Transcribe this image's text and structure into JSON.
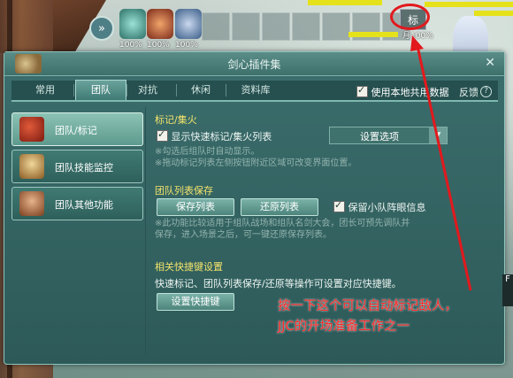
{
  "hud": {
    "buff_pcts": [
      "100%",
      "100%",
      "100%"
    ],
    "mark_label": "标",
    "mark_pct": "100%",
    "mark_prefix": "月"
  },
  "panel": {
    "title": "剑心插件集",
    "close": "✕",
    "tabs": [
      "常用",
      "团队",
      "对抗",
      "休闲",
      "资料库"
    ],
    "active_tab": "团队",
    "use_local_data_label": "使用本地共用数据",
    "feedback_label": "反馈",
    "help": "?"
  },
  "sidebar": {
    "items": [
      {
        "label": "团队/标记",
        "icon": "red-flag-icon",
        "active": true
      },
      {
        "label": "团队技能监控",
        "icon": "bell-tower-icon",
        "active": false
      },
      {
        "label": "团队其他功能",
        "icon": "gate-icon",
        "active": false
      }
    ]
  },
  "content": {
    "mark_section": {
      "title": "标记/集火",
      "show_checkbox_label": "显示快速标记/集火列表",
      "settings_select": "设置选项",
      "notes": [
        "※勾选后组队时自动显示。",
        "※拖动标记列表左侧按钮附近区域可改变界面位置。"
      ]
    },
    "save_section": {
      "title": "团队列表保存",
      "save_button": "保存列表",
      "restore_button": "还原列表",
      "keep_formation_label": "保留小队阵眼信息",
      "notes": [
        "※此功能比较适用于组队战场和组队名剑大会，团长可预先调队并",
        "保存，进入场景之后，可一键还原保存列表。"
      ]
    },
    "hotkey_section": {
      "title": "相关快捷键设置",
      "desc": "快速标记、团队列表保存/还原等操作可设置对应快捷键。",
      "button": "设置快捷键"
    }
  },
  "annotation": {
    "lines": [
      "按一下这个可以自动标记敌人，",
      "JJC的开场准备工作之一"
    ],
    "color": "#ff2b2b"
  },
  "right_edge_label": "F"
}
